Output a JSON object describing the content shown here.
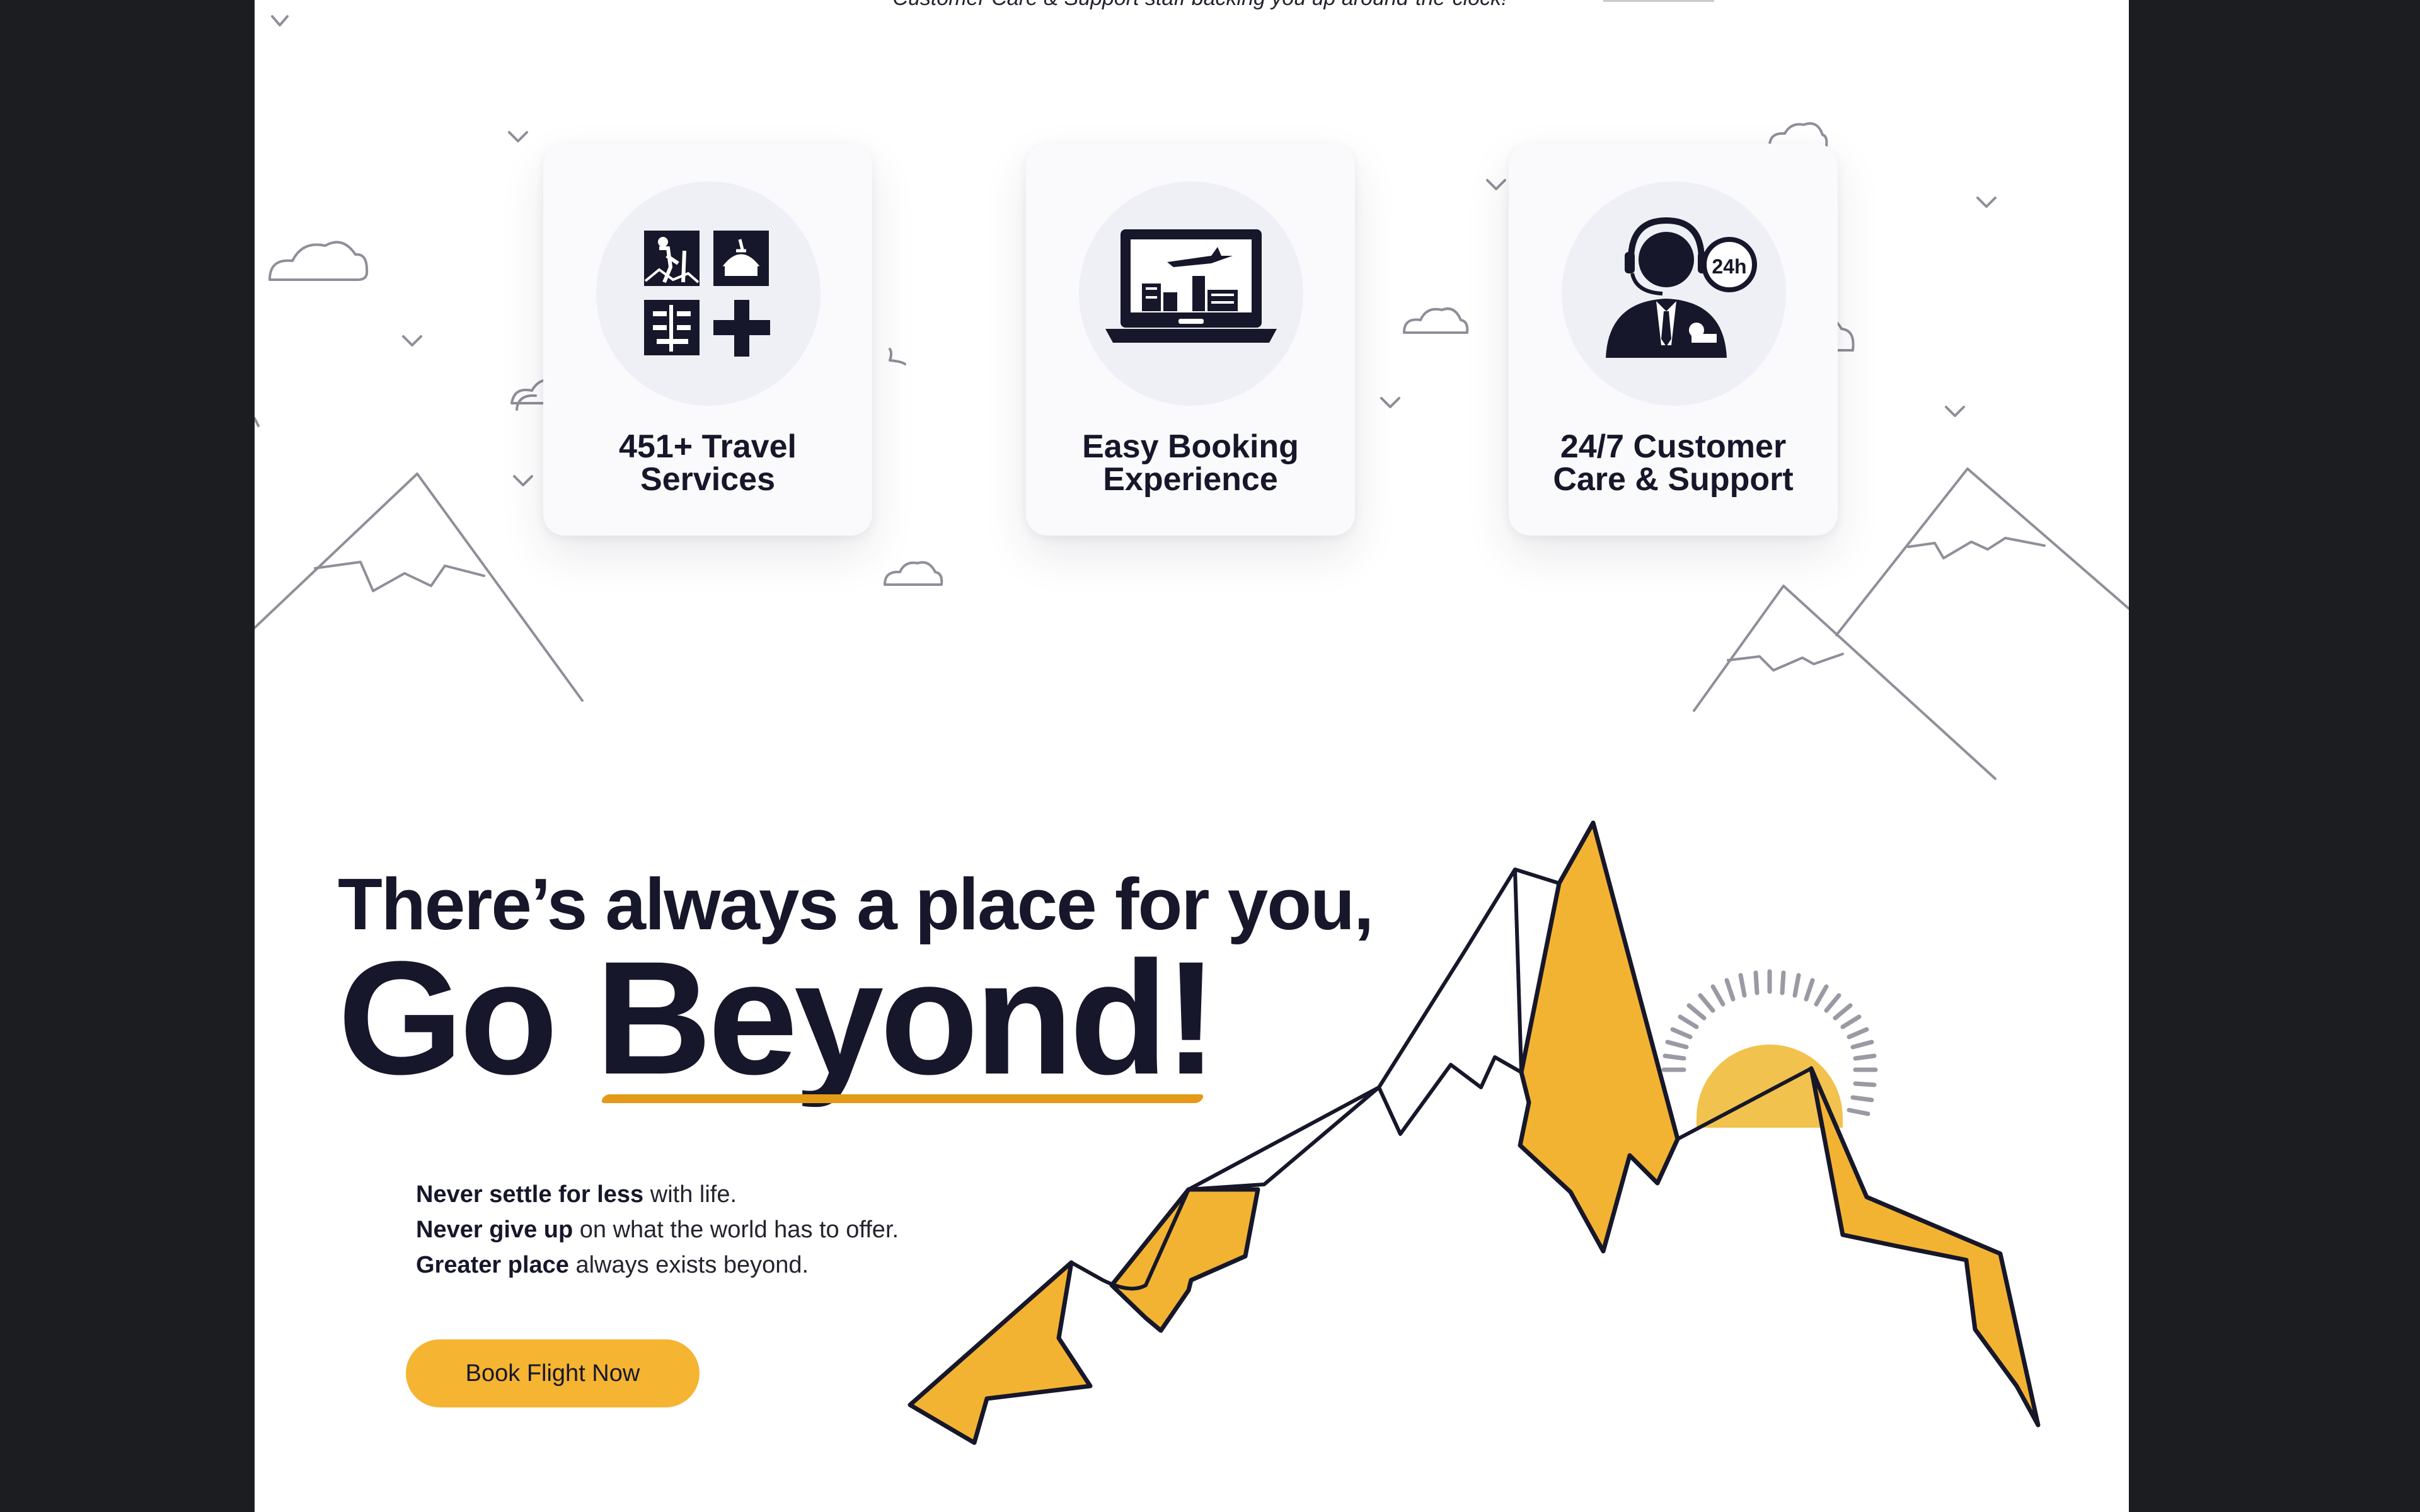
{
  "top": {
    "caption": "Customer Care & Support staff backing you up around-the-clock!"
  },
  "features": [
    {
      "label": "451+ Travel\nServices",
      "icon": "travel-services-icon"
    },
    {
      "label": "Easy Booking\nExperience",
      "icon": "laptop-booking-icon"
    },
    {
      "label": "24/7 Customer\nCare & Support",
      "icon": "customer-support-agent-icon"
    }
  ],
  "support_badge": "24h",
  "hero": {
    "headline": "There’s always a place for you,",
    "go": "Go",
    "beyond": "Beyond!",
    "lines": [
      {
        "bold": "Never settle for less",
        "rest": " with life."
      },
      {
        "bold": "Never give up",
        "rest": " on what the world has to offer."
      },
      {
        "bold": "Greater place",
        "rest": " always exists beyond."
      }
    ],
    "cta_label": "Book Flight Now"
  },
  "colors": {
    "accent": "#f5b431",
    "dark": "#16172a",
    "underline": "#e39a17",
    "line_art": "#8a8a96"
  }
}
